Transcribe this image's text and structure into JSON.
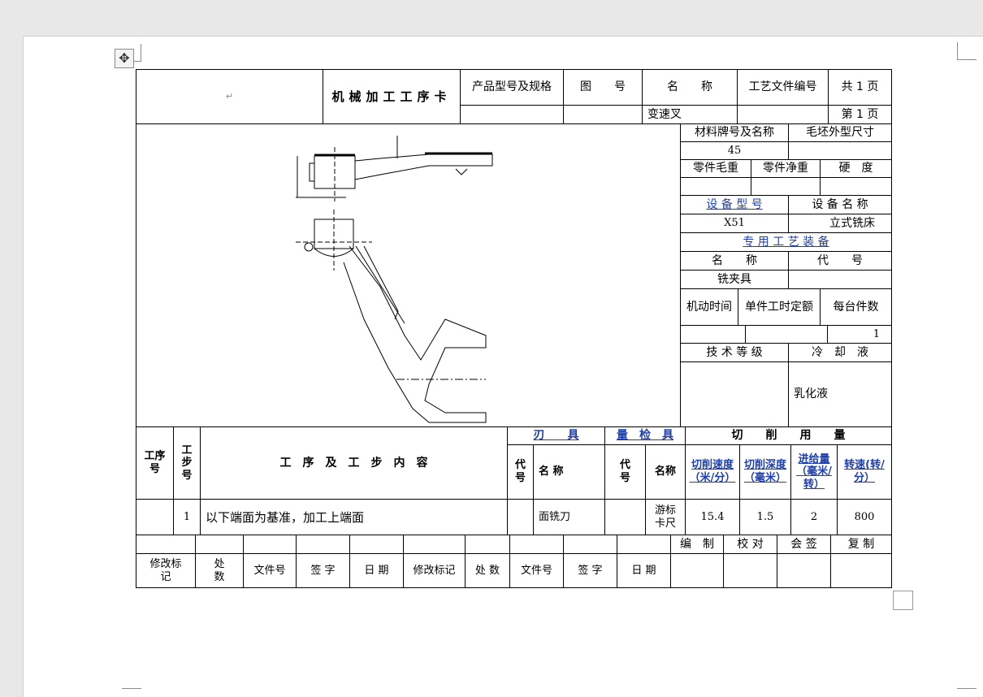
{
  "header": {
    "blank_cell": "↵",
    "card_title": "机械加工工序卡",
    "product_model_label": "产品型号及规格",
    "drawing_no_label": "图　　号",
    "name_label": "名　　称",
    "process_doc_no_label": "工艺文件编号",
    "total_pages": "共 1 页",
    "product_model_value": "",
    "drawing_no_value": "",
    "name_value": "变速叉",
    "process_doc_no_value": "",
    "page_no": "第 1 页"
  },
  "info": {
    "material_label": "材料牌号及名称",
    "blank_shape_label": "毛坯外型尺寸",
    "material_value": "45",
    "blank_shape_value": "",
    "gross_weight_label": "零件毛重",
    "net_weight_label": "零件净重",
    "hardness_label": "硬　度",
    "equipment_model_label": "设 备 型 号",
    "equipment_name_label": "设 备 名 称",
    "equipment_model_value": "X51",
    "equipment_name_value": "立式铣床",
    "special_fixture_label": "专 用 工 艺 装 备",
    "fixture_name_label": "名　　称",
    "fixture_code_label": "代　　号",
    "fixture_name_value": "铣夹具",
    "machine_time_label": "机动时间",
    "unit_time_label": "单件工时定额",
    "per_unit_label": "每台件数",
    "per_unit_value": "1",
    "tech_grade_label": "技 术 等 级",
    "coolant_label": "冷　却　液",
    "coolant_value": "乳化液"
  },
  "steps": {
    "process_no_label": "工序号",
    "step_no_label": "工步号",
    "content_label": "工　序　及　工　步　内　容",
    "tool_label": "刃　　具",
    "gauge_label": "量　检　具",
    "cutting_label": "切　　削　　用　　量",
    "code_label": "代号",
    "tool_name_label": "名 称",
    "gauge_code_label": "代号",
    "gauge_name_label": "名称",
    "speed_label": "切削速度（米/分）",
    "depth_label": "切削深度（毫米）",
    "feed_label": "进给量（毫米/转）",
    "rpm_label": "转速(转/分）",
    "rows": [
      {
        "process_no": "",
        "step_no": "1",
        "content": "以下端面为基准，加工上端面",
        "tool_code": "",
        "tool_name": "面铣刀",
        "gauge_code": "",
        "gauge_name": "游标卡尺",
        "speed": "15.4",
        "depth": "1.5",
        "feed": "2",
        "rpm": "800"
      }
    ]
  },
  "footer": {
    "compile": "编　制",
    "check": "校 对",
    "countersign": "会 签",
    "review": "复 制",
    "rev_mark": "修改标记",
    "places": "处数",
    "file_no": "文件号",
    "sign": "签 字",
    "date": "日 期",
    "rev_mark2": "修改标记",
    "places2": "处 数",
    "file_no2": "文件号",
    "sign2": "签 字",
    "date2": "日 期"
  },
  "colors": {
    "link": "#1f3fa8",
    "page": "#ffffff",
    "canvas": "#e8e8e8"
  }
}
